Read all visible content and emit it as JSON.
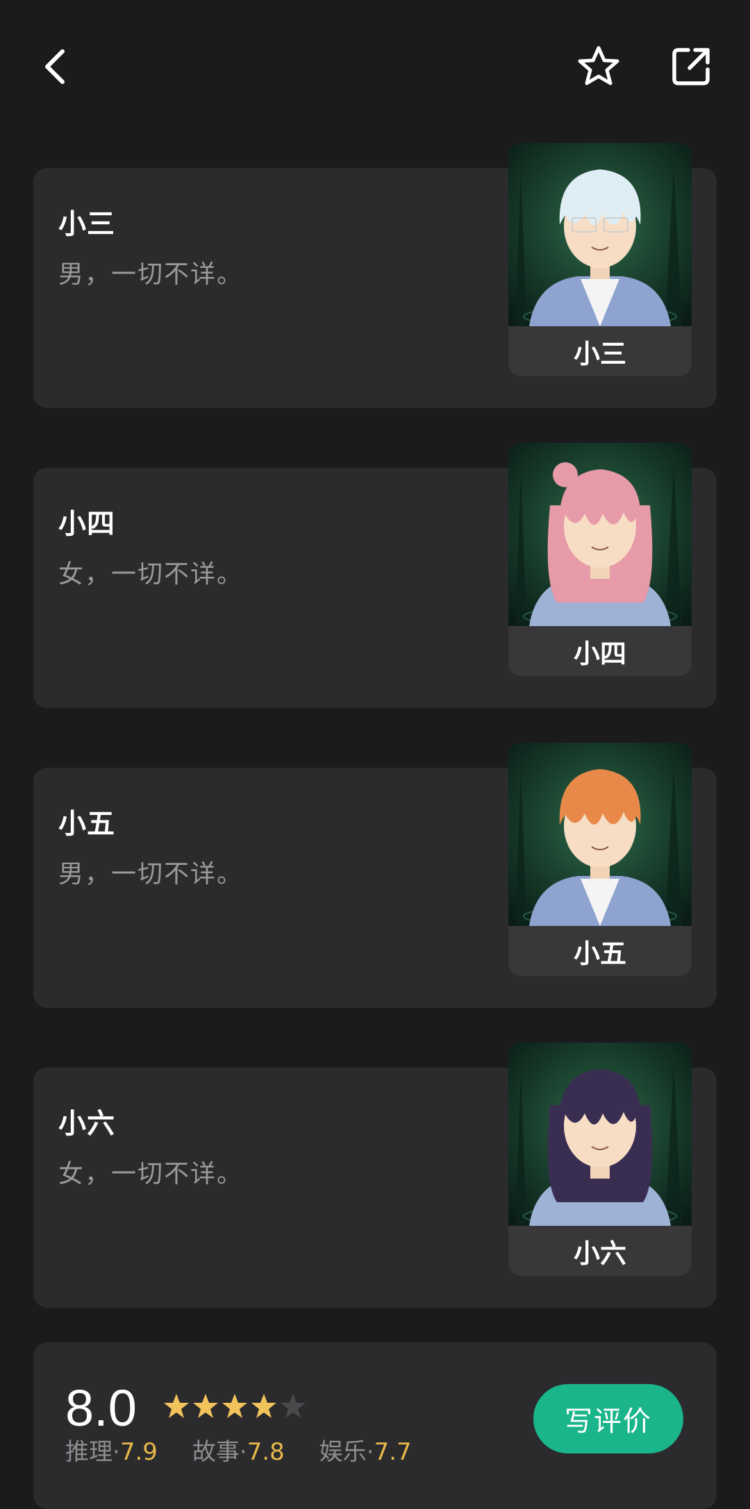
{
  "header": {
    "back_icon": "chevron-left-icon",
    "favorite_icon": "star-outline-icon",
    "share_icon": "share-external-icon"
  },
  "roles": [
    {
      "name": "小三",
      "desc": "男，一切不详。",
      "portrait_label": "小三",
      "hair_color": "#dfeef4"
    },
    {
      "name": "小四",
      "desc": "女，一切不详。",
      "portrait_label": "小四",
      "hair_color": "#e79aa8"
    },
    {
      "name": "小五",
      "desc": "男，一切不详。",
      "portrait_label": "小五",
      "hair_color": "#e8894a"
    },
    {
      "name": "小六",
      "desc": "女，一切不详。",
      "portrait_label": "小六",
      "hair_color": "#3a2d52"
    }
  ],
  "rating": {
    "score": "8.0",
    "stars_filled": 4,
    "stars_total": 5,
    "sub_scores": [
      {
        "label": "推理·",
        "value": "7.9"
      },
      {
        "label": "故事·",
        "value": "7.8"
      },
      {
        "label": "娱乐·",
        "value": "7.7"
      }
    ],
    "review_button": "写评价"
  },
  "colors": {
    "background": "#1b1b1d",
    "card": "#2b2b2e",
    "accent": "#1ab58a",
    "star": "#f3c35b",
    "star_empty": "#4a4a4d"
  }
}
